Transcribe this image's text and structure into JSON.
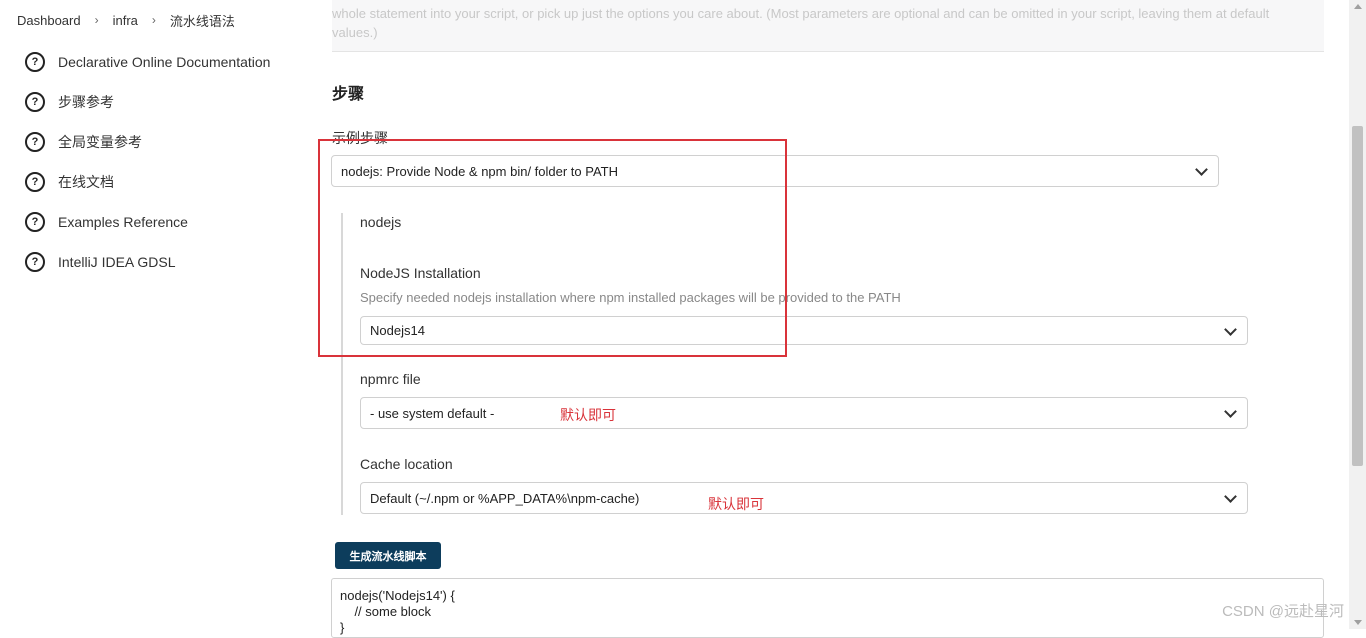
{
  "breadcrumb": {
    "items": [
      "Dashboard",
      "infra",
      "流水线语法"
    ]
  },
  "sidebar": {
    "items": [
      {
        "label": "Declarative Online Documentation"
      },
      {
        "label": "步骤参考"
      },
      {
        "label": "全局变量参考"
      },
      {
        "label": "在线文档"
      },
      {
        "label": "Examples Reference"
      },
      {
        "label": "IntelliJ IDEA GDSL"
      }
    ]
  },
  "main": {
    "intro_text": "whole statement into your script, or pick up just the options you care about. (Most parameters are optional and can be omitted in your script, leaving them at default values.)",
    "section_title": "步骤",
    "sample_step_label": "示例步骤",
    "sample_step_value": "nodejs: Provide Node & npm bin/ folder to PATH",
    "step_name": "nodejs",
    "installation": {
      "label": "NodeJS Installation",
      "help": "Specify needed nodejs installation where npm installed packages will be provided to the PATH",
      "value": "Nodejs14"
    },
    "npmrc": {
      "label": "npmrc file",
      "value": "- use system default -"
    },
    "cache": {
      "label": "Cache location",
      "value": "Default (~/.npm or %APP_DATA%\\npm-cache)"
    },
    "generate_button": "生成流水线脚本",
    "script_output": "nodejs('Nodejs14') {\n    // some block\n}"
  },
  "annotations": {
    "default_note_1": "默认即可",
    "default_note_2": "默认即可",
    "color": "#d9333a"
  },
  "watermark": "CSDN @远赴星河"
}
